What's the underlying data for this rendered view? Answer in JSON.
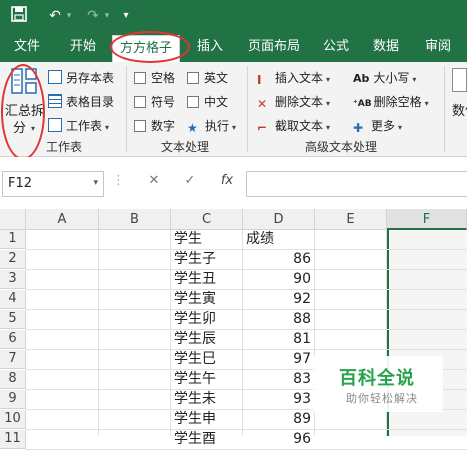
{
  "colors": {
    "brand": "#217346",
    "annotation": "#e23434",
    "watermark": "#27a34a"
  },
  "quick_access": {
    "save_icon": "save-icon",
    "undo_icon": "undo-icon",
    "redo_icon": "redo-icon",
    "customize_icon": "customize-icon"
  },
  "tabs": [
    "文件",
    "开始",
    "方方格子",
    "插入",
    "页面布局",
    "公式",
    "数据",
    "审阅"
  ],
  "active_tab": "方方格子",
  "ribbon": {
    "workbook": {
      "split_label_1": "汇总拆",
      "split_label_2": "分",
      "save_sheet": "另存本表",
      "sheet_catalog": "表格目录",
      "worksheet": "工作表",
      "group": "工作表"
    },
    "text": {
      "space": "空格",
      "english": "英文",
      "symbol": "符号",
      "chinese": "中文",
      "number": "数字",
      "execute": "执行",
      "group": "文本处理"
    },
    "advanced": {
      "insert_text": "插入文本",
      "delete_text": "删除文本",
      "cut_text": "截取文本",
      "case": "大小写",
      "delete_space": "删除空格",
      "more": "更多",
      "group": "高级文本处理"
    },
    "partial": {
      "label": "数值"
    }
  },
  "formula_bar": {
    "name_box": "F12",
    "cancel": "✕",
    "confirm": "✓",
    "fx": "fx",
    "value": ""
  },
  "sheet": {
    "columns": [
      "A",
      "B",
      "C",
      "D",
      "E",
      "F"
    ],
    "selected_column": "F",
    "rows": [
      [
        "1",
        "学生",
        "成绩"
      ],
      [
        "2",
        "学生子",
        "86"
      ],
      [
        "3",
        "学生丑",
        "90"
      ],
      [
        "4",
        "学生寅",
        "92"
      ],
      [
        "5",
        "学生卯",
        "88"
      ],
      [
        "6",
        "学生辰",
        "81"
      ],
      [
        "7",
        "学生巳",
        "97"
      ],
      [
        "8",
        "学生午",
        "83"
      ],
      [
        "9",
        "学生未",
        "93"
      ],
      [
        "10",
        "学生申",
        "89"
      ],
      [
        "11",
        "学生酉",
        "96"
      ]
    ]
  },
  "watermark": {
    "title": "百科全说",
    "subtitle": "助你轻松解决"
  }
}
